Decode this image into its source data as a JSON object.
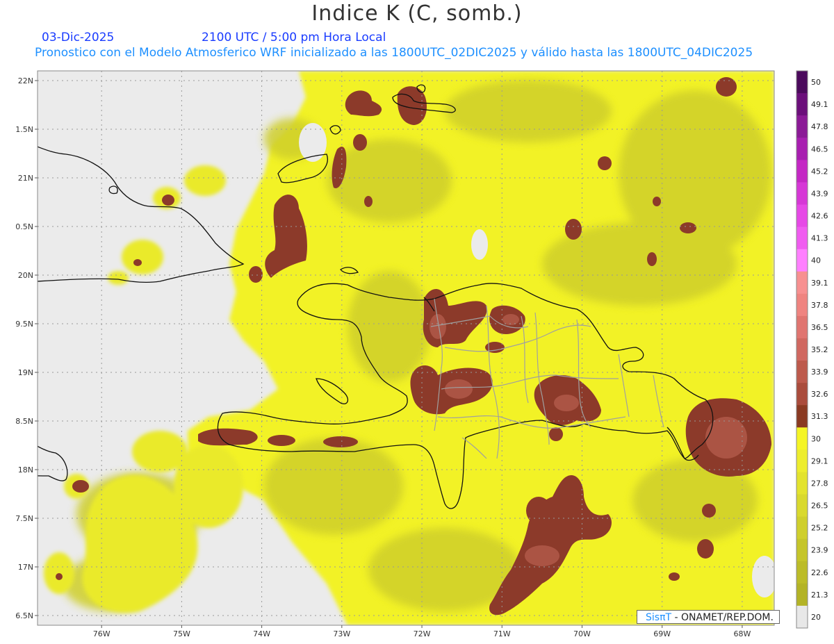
{
  "header": {
    "title": "Indice K (C, somb.)",
    "date": "03-Dic-2025",
    "time": "2100 UTC / 5:00 pm Hora Local",
    "description": "Pronostico con el Modelo Atmosferico WRF inicializado a las 1800UTC_02DIC2025 y válido hasta las  1800UTC_04DIC2025"
  },
  "map": {
    "lon_range": [
      -76.8,
      -67.6
    ],
    "lat_range": [
      16.4,
      22.1
    ],
    "lat_labels": [
      "22N",
      "1.5N",
      "21N",
      "0.5N",
      "20N",
      "9.5N",
      "19N",
      "8.5N",
      "18N",
      "7.5N",
      "17N",
      "6.5N"
    ],
    "lon_labels": [
      "76W",
      "75W",
      "74W",
      "73W",
      "72W",
      "71W",
      "70W",
      "69W",
      "68W"
    ],
    "colors": {
      "background_no_data": "#ebebeb",
      "base_yellow": "#f2f226",
      "olive": "#cfcf2a",
      "dark_brown": "#8c3a2a",
      "brown": "#9c4a38",
      "pinkish_brown": "#b85f50"
    }
  },
  "colorbar": {
    "labels": [
      "50",
      "49.1",
      "47.8",
      "46.5",
      "45.2",
      "43.9",
      "42.6",
      "41.3",
      "40",
      "39.1",
      "37.8",
      "36.5",
      "35.2",
      "33.9",
      "32.6",
      "31.3",
      "30",
      "29.1",
      "27.8",
      "26.5",
      "25.2",
      "23.9",
      "22.6",
      "21.3",
      "20"
    ],
    "colors": [
      "#4b0a5c",
      "#6b0f7a",
      "#8b1a96",
      "#a81fb0",
      "#c428c4",
      "#d638d6",
      "#e649e6",
      "#f05cf0",
      "#ff80ff",
      "#f79090",
      "#ef8480",
      "#e07570",
      "#d06860",
      "#bd5a4c",
      "#aa4c3c",
      "#8a3a22",
      "#f5f525",
      "#eded2e",
      "#e3e32e",
      "#d9d92e",
      "#cfcf2c",
      "#c5c52a",
      "#bcbc28",
      "#b3b326",
      "#e8e8e8"
    ]
  },
  "logo": {
    "brand": "SisπT",
    "text": "- ONAMET/REP.DOM."
  }
}
